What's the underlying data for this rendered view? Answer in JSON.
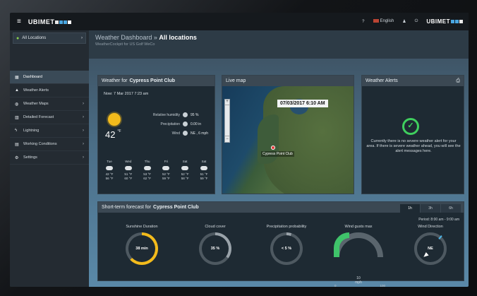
{
  "topbar": {
    "logo": "UBIMET",
    "help": "?",
    "language": "English",
    "user_icon": "user-icon",
    "power_icon": "power-icon",
    "logo_right": "UBIMET"
  },
  "sidebar": {
    "location": "All Locations",
    "items": [
      {
        "label": "Dashboard",
        "icon": "dashboard-icon",
        "active": true,
        "chevron": false
      },
      {
        "label": "Weather Alerts",
        "icon": "warning-icon",
        "active": false,
        "chevron": false
      },
      {
        "label": "Weather Maps",
        "icon": "globe-icon",
        "active": false,
        "chevron": true
      },
      {
        "label": "Detailed Forecast",
        "icon": "bar-chart-icon",
        "active": false,
        "chevron": true
      },
      {
        "label": "Lightning",
        "icon": "lightning-icon",
        "active": false,
        "chevron": true
      },
      {
        "label": "Working Conditions",
        "icon": "calendar-icon",
        "active": false,
        "chevron": true
      },
      {
        "label": "Settings",
        "icon": "gear-icon",
        "active": false,
        "chevron": true
      }
    ]
  },
  "header": {
    "breadcrumb": "Weather Dashboard »",
    "title": "All locations",
    "subtitle": "WeatherCockpit for US Golf WeCo"
  },
  "weather": {
    "title_prefix": "Weather for",
    "location": "Cypress Point Club",
    "now": "Now: 7 Mar 2017 7:23 am",
    "temp": "42",
    "unit": "°F",
    "humidity_label": "Relative humidity",
    "humidity": "95 %",
    "precip_label": "Precipitation",
    "precip": "0.00 in",
    "wind_label": "Wind",
    "wind": "NE , 6 mph",
    "days": [
      {
        "d": "Tue",
        "hi": "42 °F",
        "lo": "56 °F"
      },
      {
        "d": "Wed",
        "hi": "51 °F",
        "lo": "60 °F"
      },
      {
        "d": "Thu",
        "hi": "53 °F",
        "lo": "62 °F"
      },
      {
        "d": "Fri",
        "hi": "52 °F",
        "lo": "59 °F"
      },
      {
        "d": "Sat",
        "hi": "52 °F",
        "lo": "58 °F"
      },
      {
        "d": "Sat",
        "hi": "51 °F",
        "lo": "59 °F"
      }
    ]
  },
  "map": {
    "title": "Live map",
    "datetime": "07/03/2017 6:10 AM",
    "marker_label": "Cypress Point Club",
    "zoom_in": "+",
    "zoom_out": "−"
  },
  "alerts": {
    "title": "Weather Alerts",
    "message": "Currently there is no severe weather alert for your area. If there is severe weather ahead, you will see the alert messages here."
  },
  "shortterm": {
    "title_prefix": "Short-term forecast for",
    "location": "Cypress Point Club",
    "tabs": [
      "1h",
      "3h",
      "6h"
    ],
    "period": "Period: 8:00 am - 9:00 am",
    "sunshine_label": "Sunshine Duration",
    "sunshine_value": "38 min",
    "sunshine_fraction": 0.63,
    "cloud_label": "Cloud cover",
    "cloud_value": "35 %",
    "cloud_fraction": 0.35,
    "precip_label": "Precipitation probability",
    "precip_value": "< 5 %",
    "precip_fraction": 0.05,
    "gust_label": "Wind gusts max",
    "gust_value": "10",
    "gust_unit": "mph",
    "gust_min": "0",
    "gust_max": "100",
    "dir_label": "Wind Direction",
    "dir_value": "NE"
  },
  "colors": {
    "accent_green": "#3fcf5e",
    "sun_yellow": "#f3bb1c",
    "topbar": "#15191d",
    "sidebar": "#242b32"
  }
}
